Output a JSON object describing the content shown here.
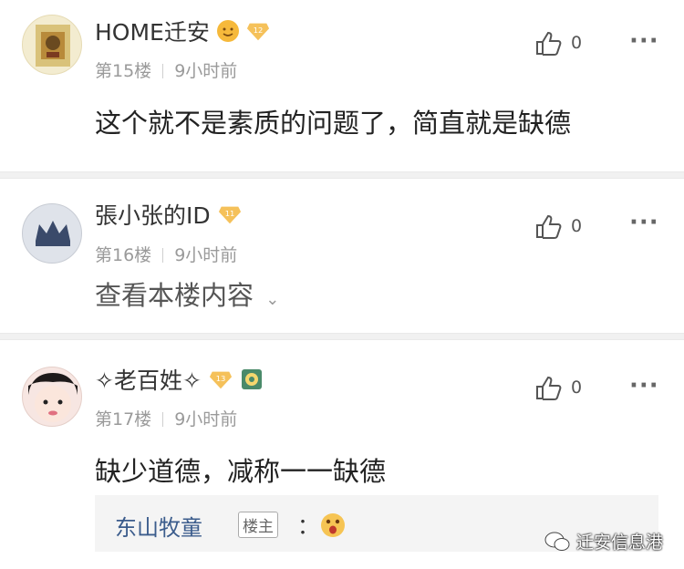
{
  "comments": [
    {
      "username": "HOME迁安",
      "floor": "第15楼",
      "time": "9小时前",
      "content": "这个就不是素质的问题了，简直就是缺德",
      "likes": "0",
      "level": "12"
    },
    {
      "username": "張小张的ID",
      "floor": "第16楼",
      "time": "9小时前",
      "content": "查看本楼内容",
      "likes": "0",
      "level": "11"
    },
    {
      "username": "✧老百姓✧",
      "floor": "第17楼",
      "time": "9小时前",
      "content": "缺少道德，减称一一缺德",
      "likes": "0",
      "level": "13"
    }
  ],
  "reply": {
    "name": "东山牧童",
    "owner_tag": "楼主",
    "colon": "："
  },
  "more_label": "···",
  "watermark": "迁安信息港",
  "colors": {
    "gold": "#f5a623",
    "link": "#3b5c8c",
    "muted": "#9a9a9a"
  }
}
